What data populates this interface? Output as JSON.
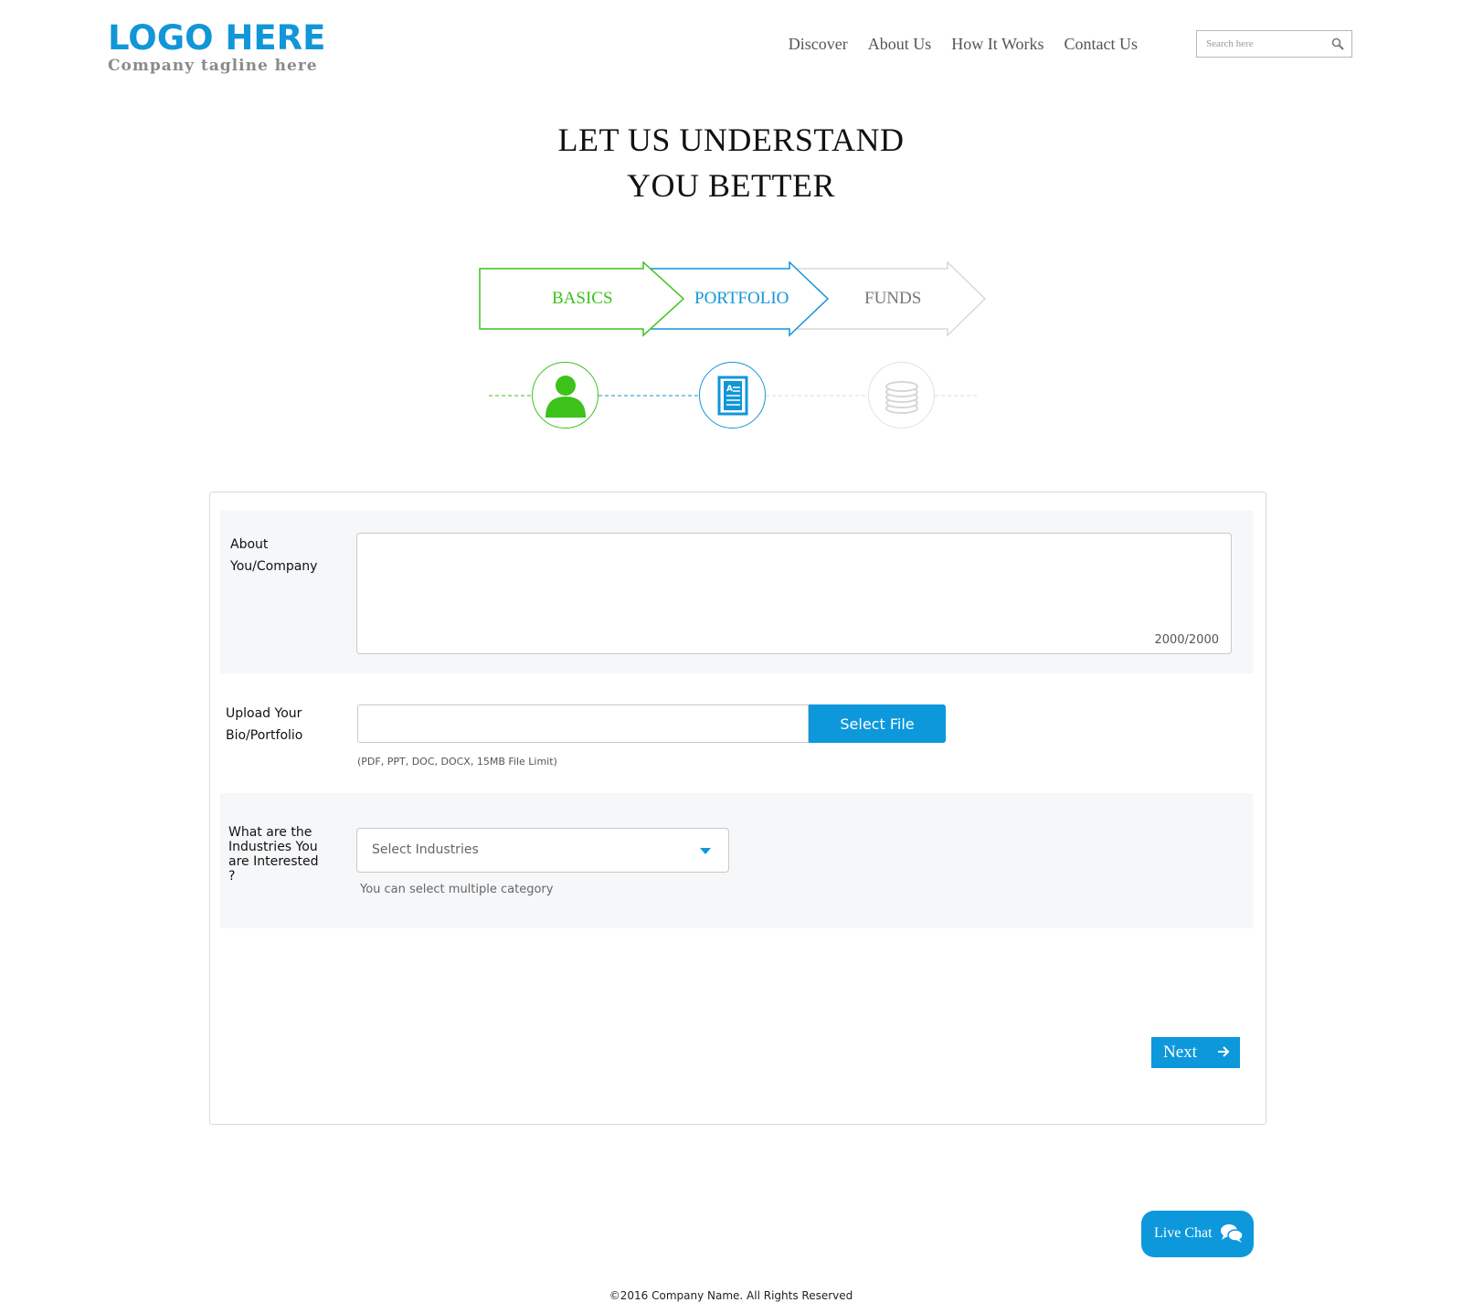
{
  "header": {
    "logo_title": "LOGO HERE",
    "logo_tagline": "Company tagline here",
    "nav": [
      "Discover",
      "About Us",
      "How It Works",
      "Contact Us"
    ],
    "search_placeholder": "Search here"
  },
  "title_line1": "LET US UNDERSTAND",
  "title_line2": "YOU BETTER",
  "steps": [
    {
      "label": "BASICS",
      "color": "#3cc21a",
      "icon": "person-icon"
    },
    {
      "label": "PORTFOLIO",
      "color": "#1196d8",
      "icon": "document-icon"
    },
    {
      "label": "FUNDS",
      "color": "#777777",
      "icon": "coins-icon"
    }
  ],
  "form": {
    "about_label": "About You/Company",
    "about_counter": "2000/2000",
    "upload_label": "Upload Your Bio/Portfolio",
    "select_file": "Select File",
    "file_hint": "(PDF, PPT, DOC, DOCX,  15MB File Limit)",
    "industries_label": "What are the Industries You are Interested ?",
    "industries_placeholder": "Select Industries",
    "industries_hint": "You can select multiple category",
    "next": "Next"
  },
  "live_chat": "Live Chat",
  "footer": "©2016 Company Name. All Rights Reserved",
  "colors": {
    "accent": "#0d98dc",
    "green": "#3cc21a",
    "muted": "#d8d8d8"
  }
}
